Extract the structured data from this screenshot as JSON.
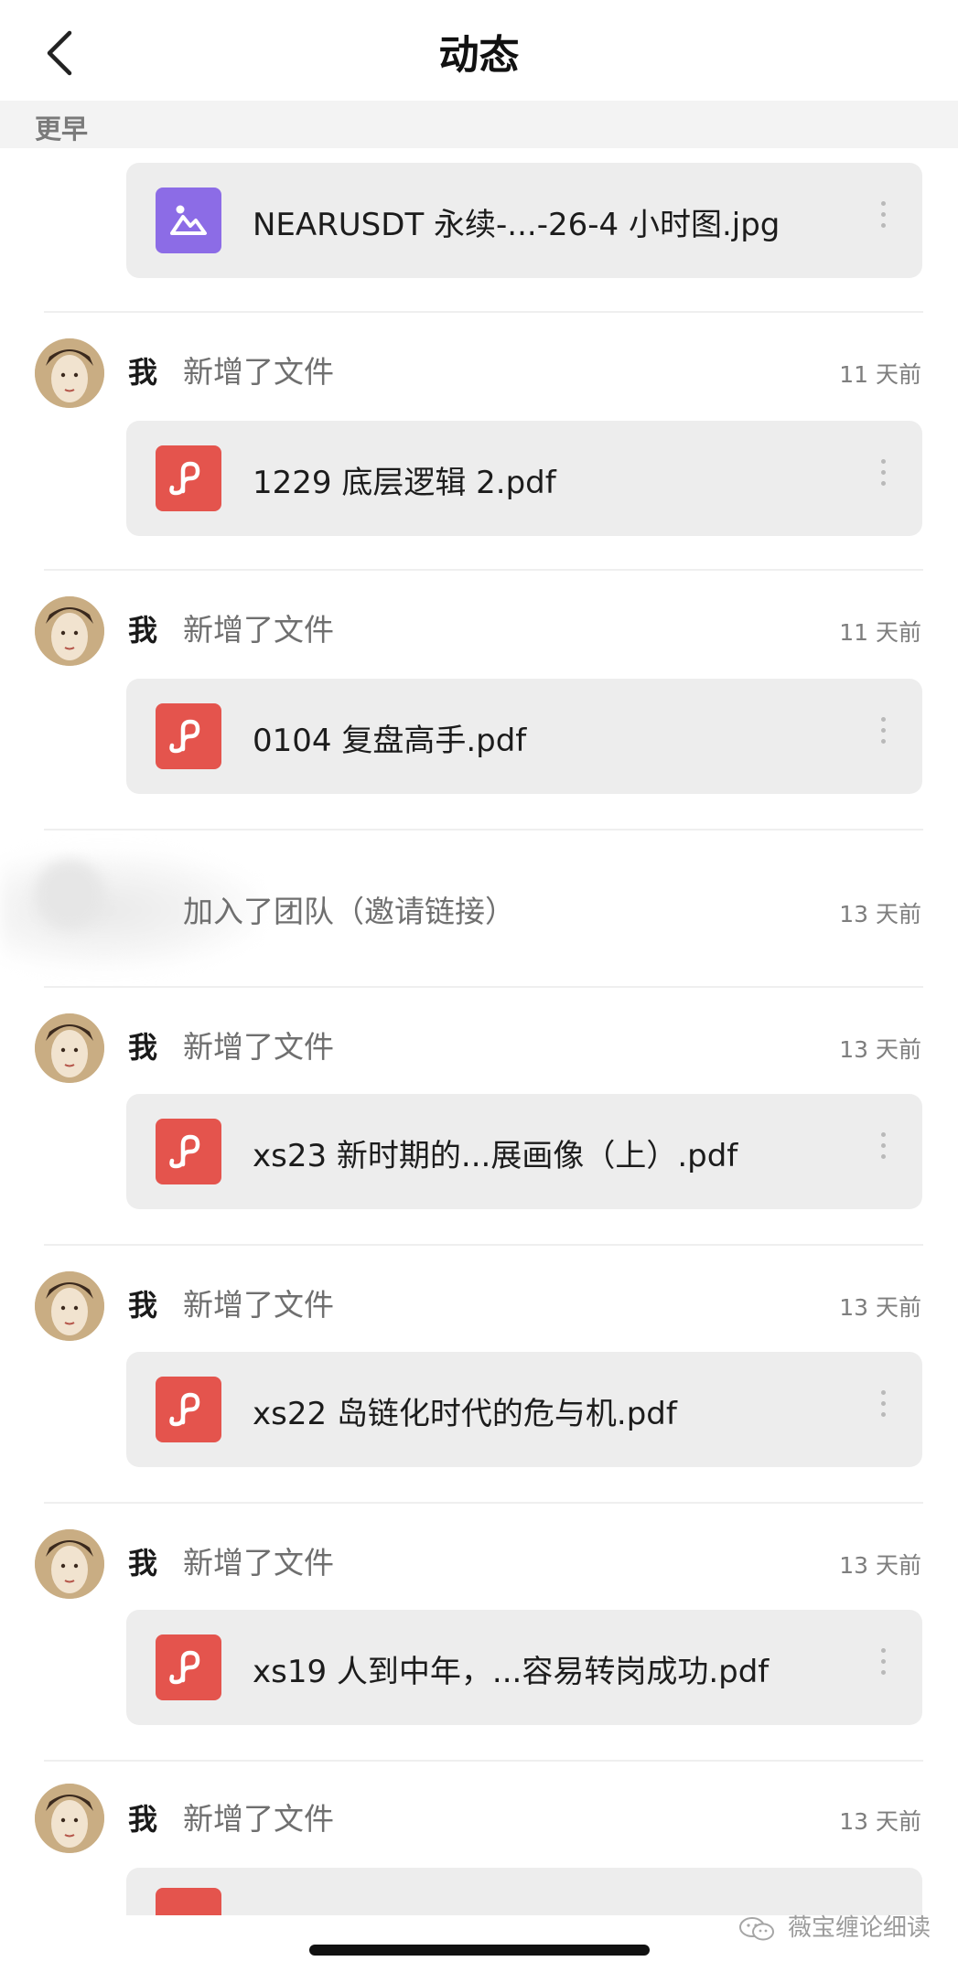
{
  "header": {
    "title": "动态",
    "back_icon": "chevron-left-icon"
  },
  "section": {
    "label": "更早"
  },
  "colors": {
    "pdf_icon": "#e4544d",
    "image_icon": "#8c6ce6",
    "card_bg": "#ededed",
    "section_bg": "#f3f3f3"
  },
  "feed": {
    "first_file": {
      "name": "NEARUSDT 永续-...-26-4 小时图.jpg",
      "icon": "image-file-icon"
    },
    "entries": [
      {
        "who": "我",
        "action": "新增了文件",
        "time": "11 天前",
        "file": "1229 底层逻辑 2.pdf"
      },
      {
        "who": "我",
        "action": "新增了文件",
        "time": "11 天前",
        "file": "0104 复盘高手.pdf"
      },
      {
        "who": "",
        "action": "加入了团队（邀请链接）",
        "time": "13 天前",
        "file": ""
      },
      {
        "who": "我",
        "action": "新增了文件",
        "time": "13 天前",
        "file": "xs23  新时期的...展画像（上）.pdf"
      },
      {
        "who": "我",
        "action": "新增了文件",
        "time": "13 天前",
        "file": "xs22 岛链化时代的危与机.pdf"
      },
      {
        "who": "我",
        "action": "新增了文件",
        "time": "13 天前",
        "file": "xs19  人到中年，...容易转岗成功.pdf"
      },
      {
        "who": "我",
        "action": "新增了文件",
        "time": "13 天前",
        "file": ""
      }
    ]
  },
  "watermark": {
    "text": "薇宝缠论细读"
  }
}
